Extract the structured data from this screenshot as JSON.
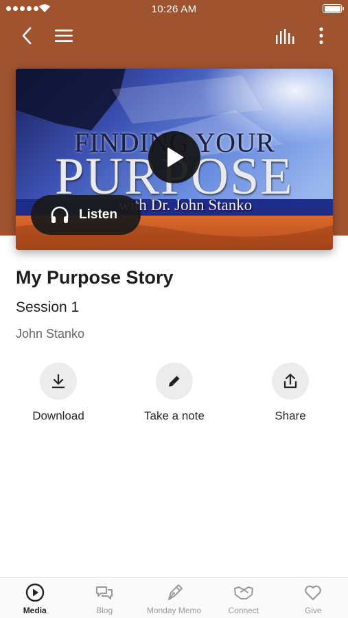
{
  "status_bar": {
    "time": "10:26 AM"
  },
  "nav": {
    "back_icon": "chevron-left-icon",
    "menu_icon": "hamburger-icon",
    "audio_icon": "equalizer-icon",
    "more_icon": "more-vertical-icon"
  },
  "media": {
    "thumbnail": {
      "title_line1": "FINDING YOUR",
      "title_line2": "PURPOSE",
      "subtitle": "with Dr. John Stanko"
    },
    "listen_label": "Listen",
    "title": "My Purpose Story",
    "session": "Session 1",
    "author": "John Stanko"
  },
  "actions": [
    {
      "label": "Download",
      "icon": "download-icon"
    },
    {
      "label": "Take a note",
      "icon": "pencil-icon"
    },
    {
      "label": "Share",
      "icon": "share-icon"
    }
  ],
  "tabs": [
    {
      "label": "Media",
      "icon": "play-circle-icon",
      "active": true
    },
    {
      "label": "Blog",
      "icon": "chat-bubbles-icon",
      "active": false
    },
    {
      "label": "Monday Memo",
      "icon": "pen-nib-icon",
      "active": false
    },
    {
      "label": "Connect",
      "icon": "handshake-icon",
      "active": false
    },
    {
      "label": "Give",
      "icon": "heart-icon",
      "active": false
    }
  ],
  "colors": {
    "header_bg": "#a0532f",
    "active_tab": "#222222",
    "inactive_tab": "#9a9a9a"
  }
}
